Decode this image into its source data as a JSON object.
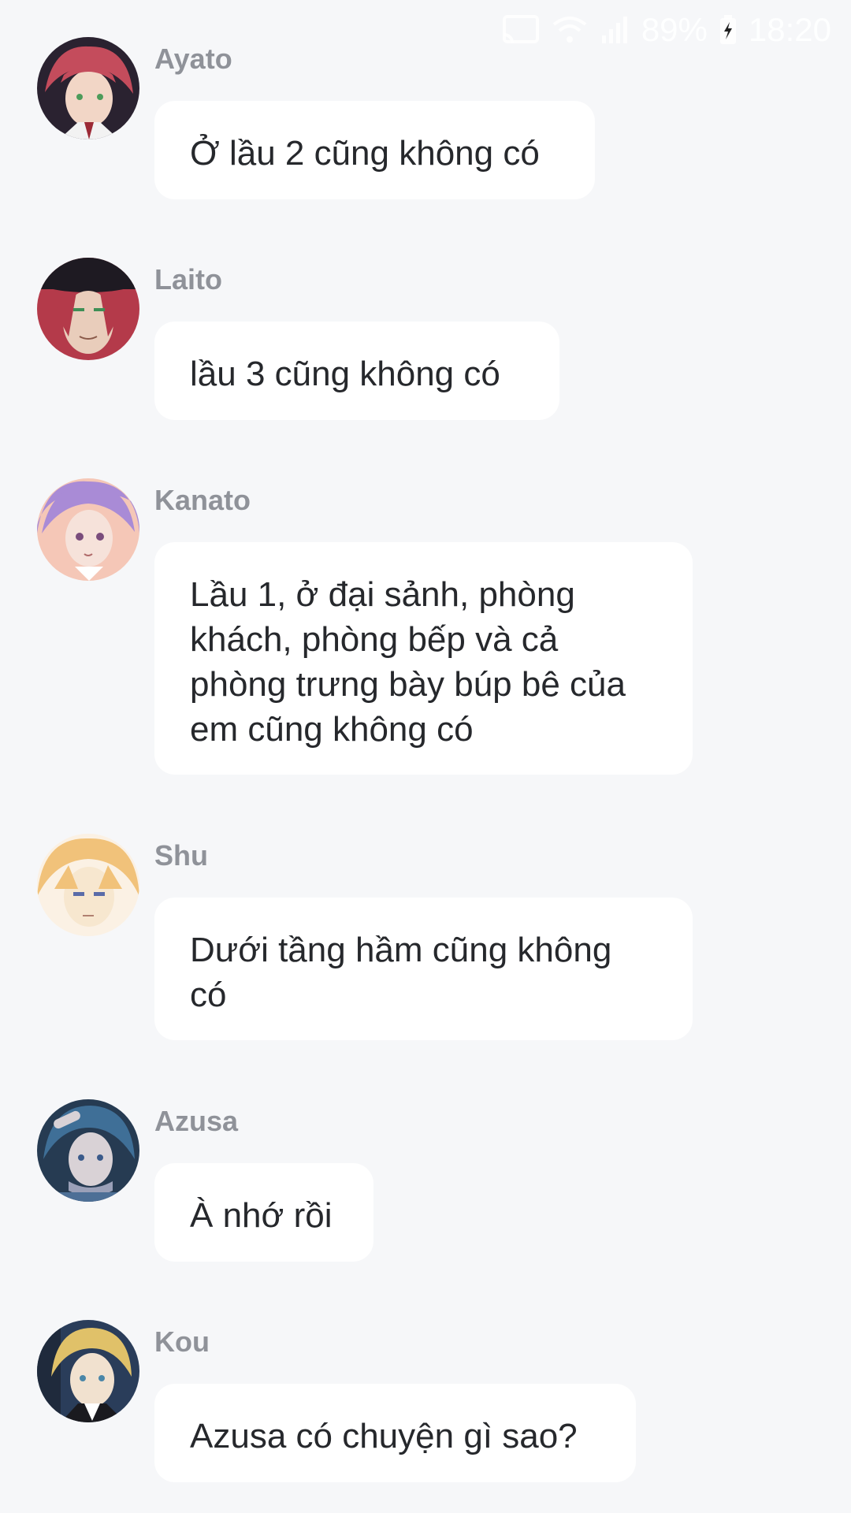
{
  "status_bar": {
    "battery": "89%",
    "time": "18:20",
    "icons": [
      "cast-icon",
      "wifi-icon",
      "signal-icon",
      "battery-icon"
    ]
  },
  "messages": [
    {
      "sender": "Ayato",
      "text": "Ở lầu 2 cũng không có",
      "avatar_colors": [
        "#c44c5c",
        "#2b2430",
        "#f2d6c6"
      ]
    },
    {
      "sender": "Laito",
      "text": "lầu 3 cũng không có",
      "avatar_colors": [
        "#b43a4a",
        "#1e1a22",
        "#e9cdbb"
      ]
    },
    {
      "sender": "Kanato",
      "text": "Lầu 1, ở đại sảnh, phòng khách, phòng bếp và cả phòng trưng bày búp bê của em cũng không có",
      "avatar_colors": [
        "#a98bd6",
        "#f5c7b7",
        "#f6e2da"
      ]
    },
    {
      "sender": "Shu",
      "text": "Dưới tầng hầm cũng không có",
      "avatar_colors": [
        "#f1c27a",
        "#f7e7cf",
        "#fbf1e4"
      ]
    },
    {
      "sender": "Azusa",
      "text": "À nhớ rồi",
      "avatar_colors": [
        "#3f6f97",
        "#263b52",
        "#d9d2d6"
      ]
    },
    {
      "sender": "Kou",
      "text": "Azusa có chuyện gì sao?",
      "avatar_colors": [
        "#e0c169",
        "#1f2a3c",
        "#f1e1cf"
      ]
    }
  ]
}
